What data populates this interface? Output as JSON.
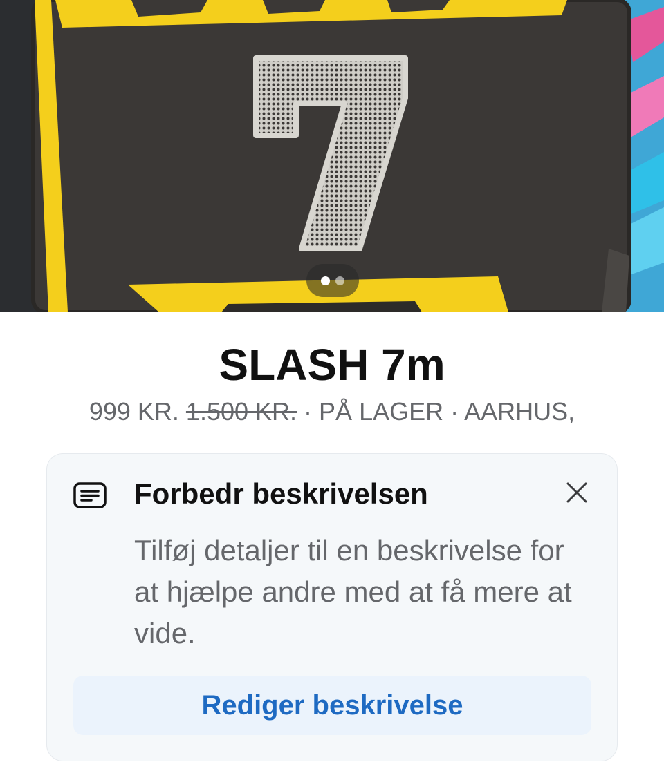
{
  "photo": {
    "number_graphic": "7",
    "slides_total": 2,
    "slides_active": 1
  },
  "listing": {
    "title": "SLASH 7m",
    "price": "999 KR.",
    "old_price": "1.500 KR.",
    "stock": "· PÅ LAGER · AARHUS,"
  },
  "suggestion": {
    "icon": "text-description-icon",
    "title": "Forbedr beskrivelsen",
    "body": "Tilføj detaljer til en beskrivelse for at hjælpe andre med at få mere at vide.",
    "button_label": "Rediger beskrivelse",
    "close_icon": "close-icon"
  },
  "colors": {
    "accent": "#1e6ac2",
    "button_bg": "#ebf3fc",
    "card_bg": "#f5f8fa",
    "muted_text": "#65676b",
    "bag_yellow": "#f4cf1c",
    "bag_body": "#3b3836"
  }
}
